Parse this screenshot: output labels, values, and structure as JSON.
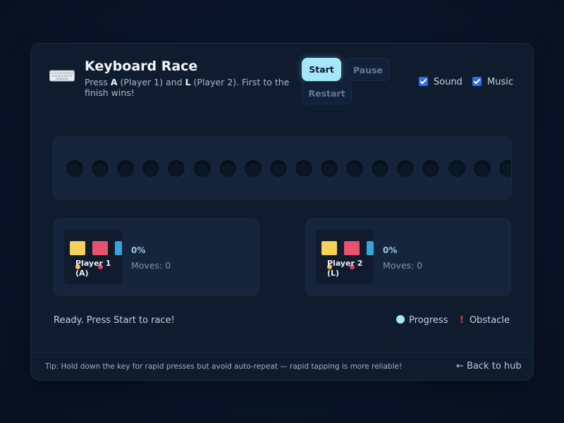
{
  "header": {
    "icon": "keyboard-icon",
    "title": "Keyboard Race",
    "subtitle_parts": {
      "press": "Press ",
      "key1": "A",
      "p1": " (Player 1) and ",
      "key2": "L",
      "p2": " (Player 2). First to the finish wins!"
    }
  },
  "controls": {
    "start": "Start",
    "pause": "Pause",
    "restart": "Restart"
  },
  "toggles": {
    "sound": {
      "label": "Sound",
      "checked": true
    },
    "music": {
      "label": "Music",
      "checked": true
    }
  },
  "players": [
    {
      "name_line1": "Player 1",
      "name_line2": "(A)",
      "progress": "0%",
      "moves": "Moves: 0",
      "progress_fraction": 0
    },
    {
      "name_line1": "Player 2",
      "name_line2": "(L)",
      "progress": "0%",
      "moves": "Moves: 0",
      "progress_fraction": 0
    }
  ],
  "status": "Ready. Press Start to race!",
  "legend": {
    "progress": "Progress",
    "obstacle": "Obstacle"
  },
  "footer": {
    "tip": "Tip: Hold down the key for rapid presses but avoid auto-repeat — rapid tapping is more reliable!",
    "back": "← Back to hub"
  },
  "colors": {
    "accent": "#a6e6fa",
    "obstacle": "#e33a3a",
    "checkbox": "#2f6fea"
  }
}
